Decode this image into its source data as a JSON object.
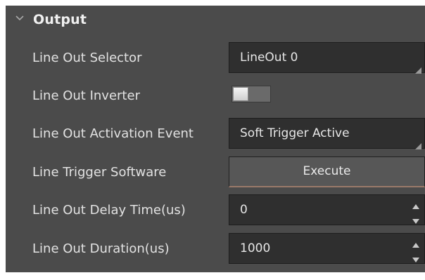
{
  "section": {
    "title": "Output",
    "expanded_icon": "chevron-down-icon"
  },
  "rows": {
    "line_out_selector": {
      "label": "Line Out Selector",
      "value": "LineOut 0"
    },
    "line_out_inverter": {
      "label": "Line Out Inverter",
      "state": "off"
    },
    "line_out_activation_event": {
      "label": "Line Out Activation Event",
      "value": "Soft Trigger Active"
    },
    "line_trigger_software": {
      "label": "Line Trigger Software",
      "button_label": "Execute"
    },
    "line_out_delay_time": {
      "label": "Line Out Delay Time(us)",
      "value": "0"
    },
    "line_out_duration": {
      "label": "Line Out Duration(us)",
      "value": "1000"
    }
  },
  "colors": {
    "panel_background": "#4b4b4b",
    "field_background": "#2f2f2f",
    "button_background": "#575757",
    "text": "#e6e6e6"
  }
}
